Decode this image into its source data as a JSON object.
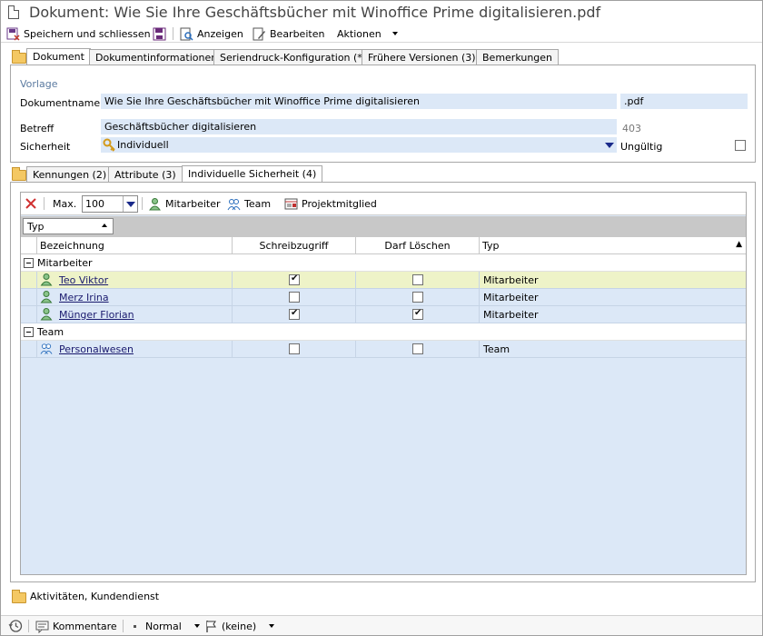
{
  "window": {
    "title": "Dokument: Wie Sie Ihre Geschäftsbücher mit Winoffice Prime digitalisieren.pdf"
  },
  "toolbar": {
    "save_close": "Speichern und schliessen",
    "view": "Anzeigen",
    "edit": "Bearbeiten",
    "actions": "Aktionen"
  },
  "tabs": [
    "Dokument",
    "Dokumentinformationen",
    "Seriendruck-Konfiguration (*)",
    "Frühere Versionen (3)",
    "Bemerkungen"
  ],
  "form": {
    "template_label": "Vorlage",
    "docname_label": "Dokumentname",
    "docname_value": "Wie Sie Ihre Geschäftsbücher mit Winoffice Prime digitalisieren",
    "extension": ".pdf",
    "subject_label": "Betreff",
    "subject_value": "Geschäftsbücher digitalisieren",
    "number": "403",
    "security_label": "Sicherheit",
    "security_value": "Individuell",
    "invalid_label": "Ungültig"
  },
  "subtabs": [
    "Kennungen (2)",
    "Attribute (3)",
    "Individuelle Sicherheit (4)"
  ],
  "grid_toolbar": {
    "max_label": "Max.",
    "max_value": "100",
    "employee": "Mitarbeiter",
    "team": "Team",
    "project_member": "Projektmitglied"
  },
  "group_chip": "Typ",
  "columns": [
    "Bezeichnung",
    "Schreibzugriff",
    "Darf Löschen",
    "Typ"
  ],
  "groups": [
    {
      "name": "Mitarbeiter",
      "rows": [
        {
          "name": "Teo Viktor",
          "write": true,
          "delete": false,
          "type": "Mitarbeiter"
        },
        {
          "name": "Merz Irina",
          "write": false,
          "delete": false,
          "type": "Mitarbeiter"
        },
        {
          "name": "Münger Florian",
          "write": true,
          "delete": true,
          "type": "Mitarbeiter"
        }
      ]
    },
    {
      "name": "Team",
      "rows": [
        {
          "name": "Personalwesen",
          "write": false,
          "delete": false,
          "type": "Team"
        }
      ]
    }
  ],
  "activities": "Aktivitäten, Kundendienst",
  "statusbar": {
    "comments": "Kommentare",
    "priority": "Normal",
    "flag": "(keine)"
  }
}
